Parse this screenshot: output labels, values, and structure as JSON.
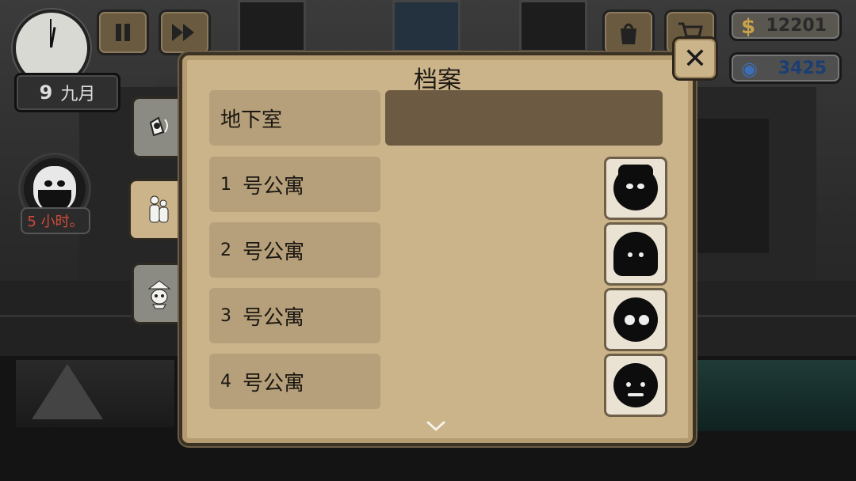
{
  "hud": {
    "date_day": "9",
    "date_month": "九月",
    "pause_icon": "pause-icon",
    "fast_forward_icon": "fast-forward-icon",
    "bag_icon": "bag-icon",
    "cart_icon": "cart-icon",
    "cash_symbol": "$",
    "cash_amount": "12201",
    "gem_amount": "3425",
    "tenant_timer": "5 小时。"
  },
  "dossier": {
    "title": "档案",
    "tabs": [
      {
        "name": "listening-device-tab",
        "icon": "speaker-icon"
      },
      {
        "name": "tenants-tab",
        "icon": "people-icon",
        "active": true
      },
      {
        "name": "landlord-tab",
        "icon": "masked-figure-icon"
      }
    ],
    "rows": [
      {
        "label": "地下室",
        "number": ""
      },
      {
        "label": "号公寓",
        "number": "1",
        "portrait": "tenant-with-hat"
      },
      {
        "label": "号公寓",
        "number": "2",
        "portrait": "hooded-tenant"
      },
      {
        "label": "号公寓",
        "number": "3",
        "portrait": "tenant-with-glasses"
      },
      {
        "label": "号公寓",
        "number": "4",
        "portrait": "bald-tenant"
      }
    ]
  },
  "colors": {
    "panel": "#cbb38a",
    "row": "#b6a07b",
    "basement_bar": "#6c5a43",
    "timer_text": "#d24a3a",
    "gem_text": "#1b3e73"
  }
}
